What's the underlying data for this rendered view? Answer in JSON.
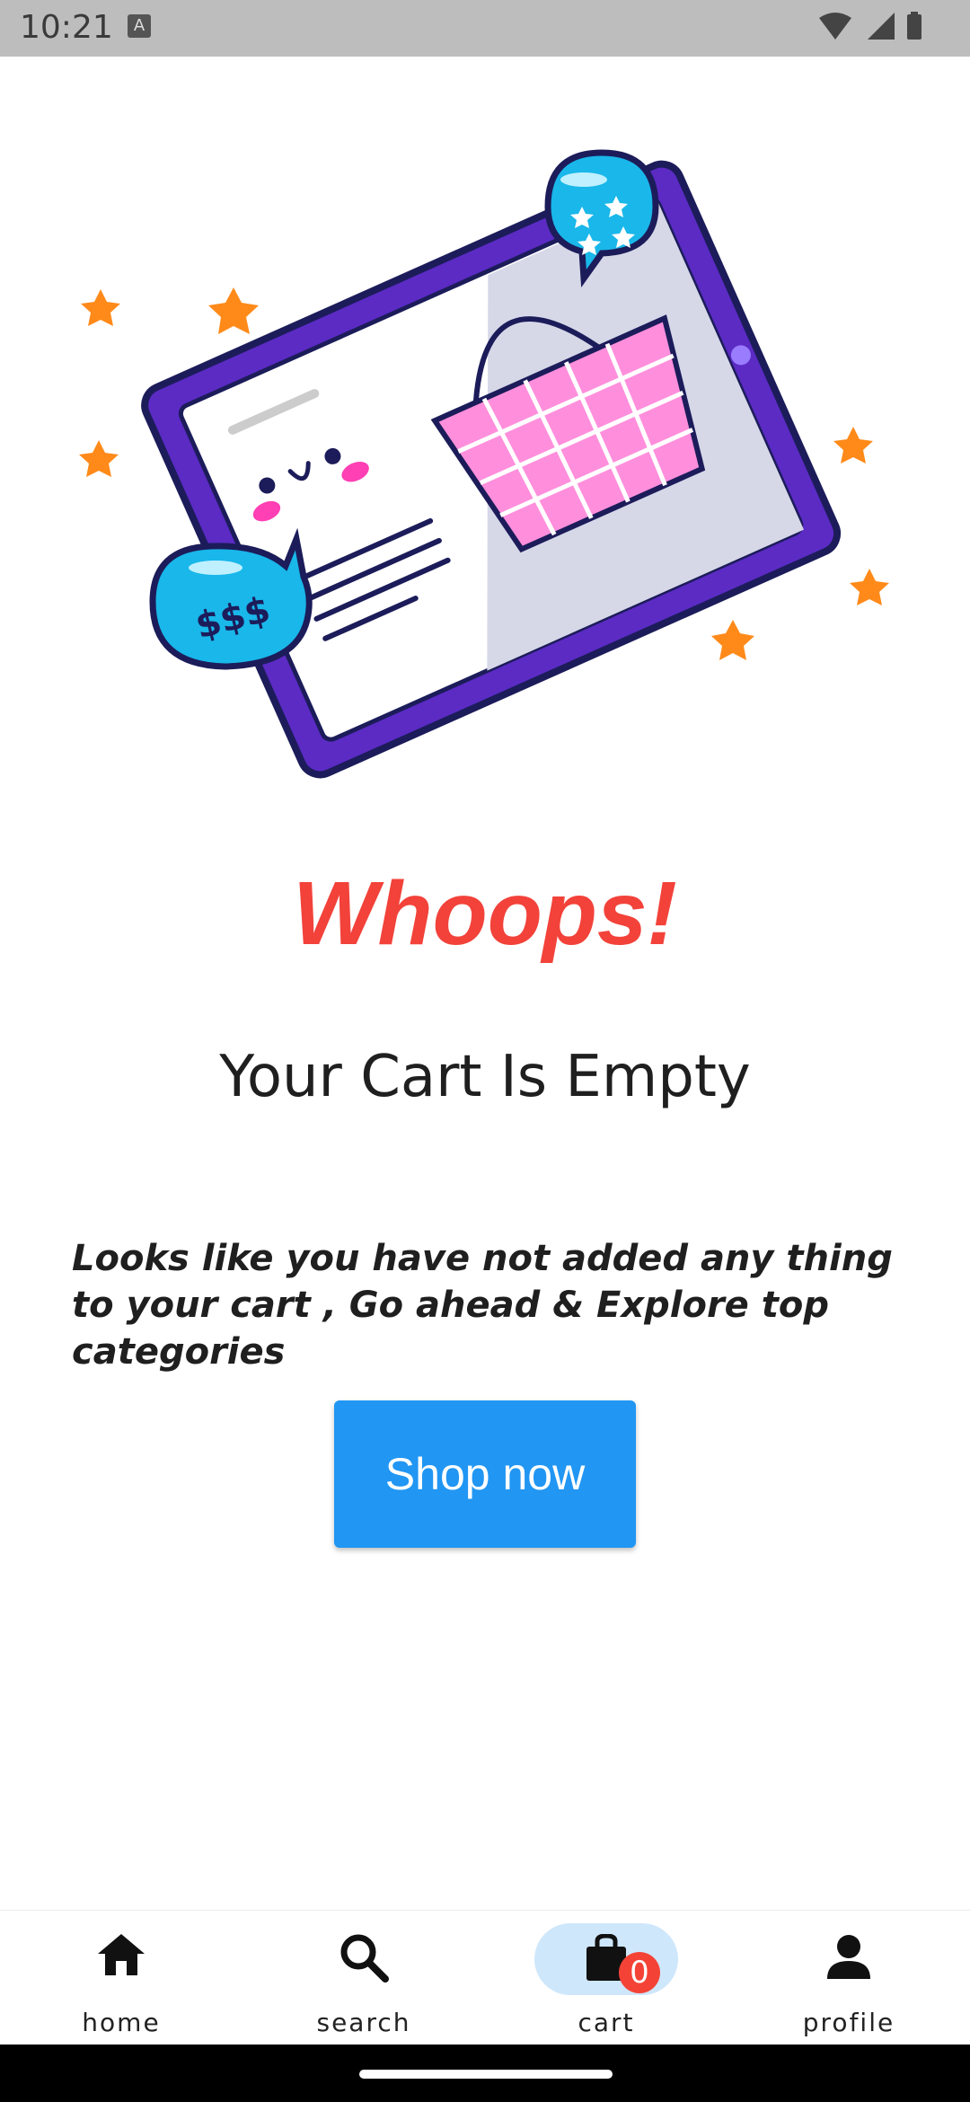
{
  "status_bar": {
    "time": "10:21",
    "notification_icon": "A"
  },
  "illustration": {
    "bubble_text": "$$$"
  },
  "empty_state": {
    "title": "Whoops!",
    "subtitle": "Your Cart Is Empty",
    "message": "Looks like you have not added any thing to your cart , Go ahead & Explore top categories",
    "button_label": "Shop now"
  },
  "bottom_nav": {
    "items": [
      {
        "label": "home",
        "icon": "home-icon"
      },
      {
        "label": "search",
        "icon": "search-icon"
      },
      {
        "label": "cart",
        "icon": "shopping-bag-icon",
        "badge": "0",
        "active": true
      },
      {
        "label": "profile",
        "icon": "person-icon"
      }
    ]
  },
  "colors": {
    "accent": "#2196f3",
    "title": "#f2423a",
    "active_indicator": "#cfe7fb",
    "badge": "#f44336"
  }
}
